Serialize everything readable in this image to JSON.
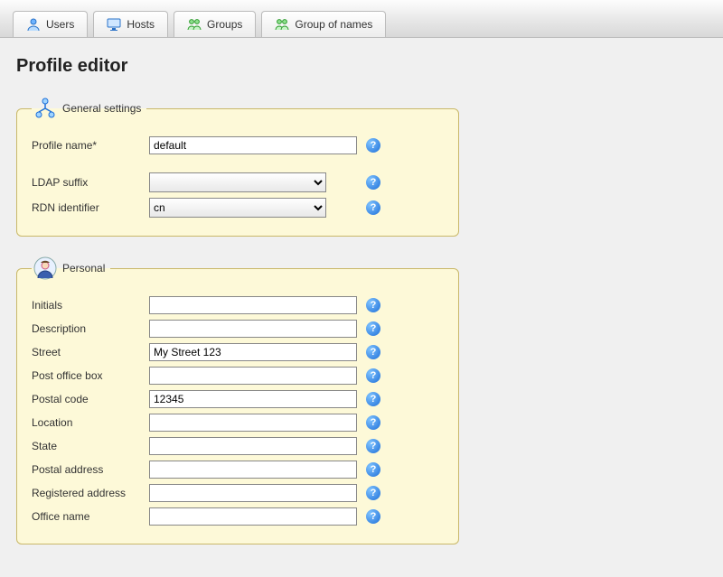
{
  "tabs": {
    "users": "Users",
    "hosts": "Hosts",
    "groups": "Groups",
    "group_of_names": "Group of names"
  },
  "page_title": "Profile editor",
  "general": {
    "legend": "General settings",
    "profile_name_label": "Profile name*",
    "profile_name_value": "default",
    "ldap_suffix_label": "LDAP suffix",
    "ldap_suffix_value": "",
    "rdn_label": "RDN identifier",
    "rdn_value": "cn"
  },
  "personal": {
    "legend": "Personal",
    "fields": {
      "initials": {
        "label": "Initials",
        "value": ""
      },
      "description": {
        "label": "Description",
        "value": ""
      },
      "street": {
        "label": "Street",
        "value": "My Street 123"
      },
      "post_office_box": {
        "label": "Post office box",
        "value": ""
      },
      "postal_code": {
        "label": "Postal code",
        "value": "12345"
      },
      "location": {
        "label": "Location",
        "value": ""
      },
      "state": {
        "label": "State",
        "value": ""
      },
      "postal_address": {
        "label": "Postal address",
        "value": ""
      },
      "registered_address": {
        "label": "Registered address",
        "value": ""
      },
      "office_name": {
        "label": "Office name",
        "value": ""
      }
    }
  },
  "help_glyph": "?"
}
